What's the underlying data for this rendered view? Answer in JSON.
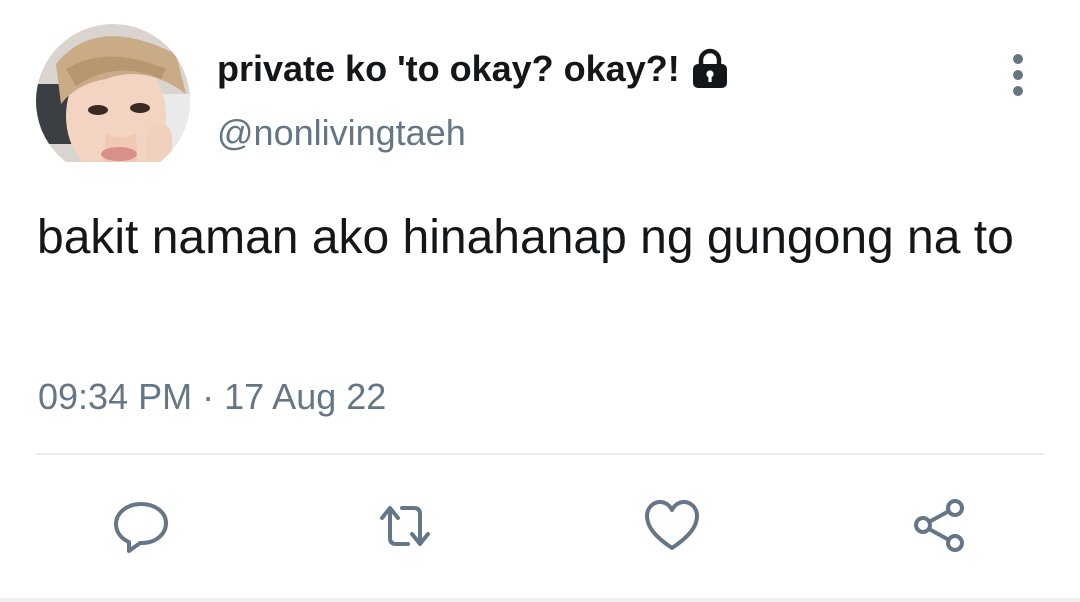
{
  "author": {
    "display_name": "private ko 'to okay? okay?!",
    "handle": "@nonlivingtaeh",
    "protected_icon": "lock-icon",
    "avatar": "profile-photo"
  },
  "tweet": {
    "text": "bakit naman ako hinahanap ng gungong na to",
    "time": "09:34 PM",
    "separator": "·",
    "date": "17 Aug 22"
  },
  "menu_icon": "more-vertical-icon",
  "actions": [
    {
      "name": "reply",
      "icon": "reply-icon"
    },
    {
      "name": "retweet",
      "icon": "retweet-icon"
    },
    {
      "name": "like",
      "icon": "heart-icon"
    },
    {
      "name": "share",
      "icon": "share-icon"
    }
  ],
  "colors": {
    "text": "#14171a",
    "secondary": "#657786",
    "divider": "#e6ecf0"
  }
}
